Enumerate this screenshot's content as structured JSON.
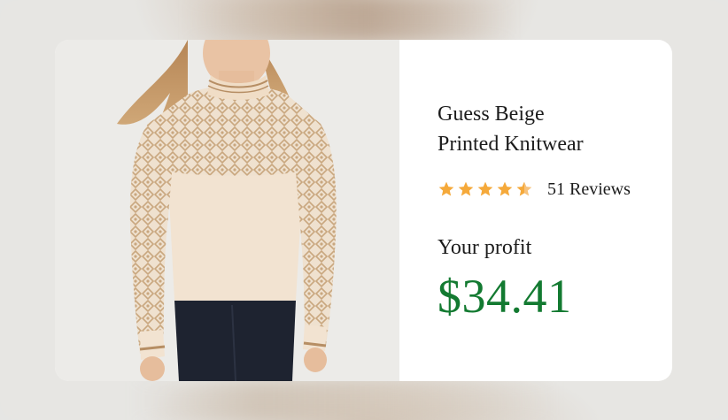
{
  "product": {
    "title_line1": "Guess Beige",
    "title_line2": "Printed Knitwear",
    "rating": 4.5,
    "rating_max": 5,
    "reviews_label": "51 Reviews",
    "profit_label": "Your profit",
    "price": "$34.41"
  },
  "colors": {
    "price": "#137a31",
    "star": "#f5a93a",
    "star_empty": "#e3e3e3"
  },
  "icons": {
    "star": "star-icon",
    "half_star": "star-half-icon"
  }
}
